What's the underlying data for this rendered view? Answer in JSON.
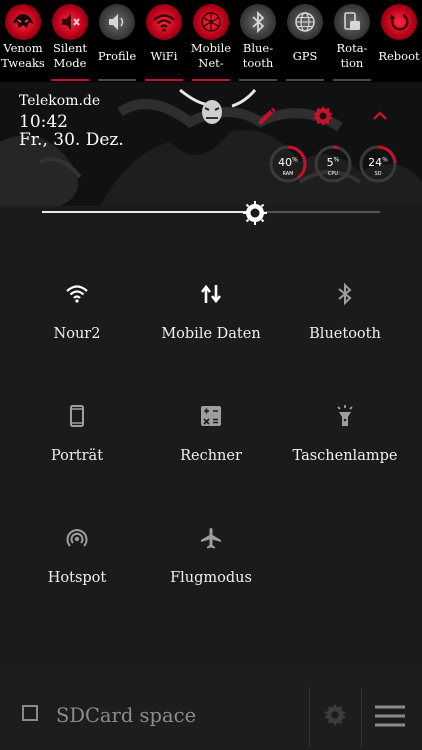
{
  "toggles": [
    {
      "line1": "Venom",
      "line2": "Tweaks",
      "icon": "venom-logo-icon",
      "active": true
    },
    {
      "line1": "Silent",
      "line2": "Mode",
      "icon": "speaker-mute-icon",
      "active": true
    },
    {
      "line1": "Profile",
      "line2": "",
      "icon": "speaker-icon",
      "active": false
    },
    {
      "line1": "WiFi",
      "line2": "",
      "icon": "wifi-icon",
      "active": true
    },
    {
      "line1": "Mobile",
      "line2": "Net-",
      "icon": "mobile-network-icon",
      "active": true
    },
    {
      "line1": "Blue-",
      "line2": "tooth",
      "icon": "bluetooth-icon",
      "active": false
    },
    {
      "line1": "GPS",
      "line2": "",
      "icon": "globe-icon",
      "active": false
    },
    {
      "line1": "Rota-",
      "line2": "tion",
      "icon": "rotation-icon",
      "active": false
    },
    {
      "line1": "Reboot",
      "line2": "",
      "icon": "reboot-icon",
      "active": true
    }
  ],
  "header": {
    "carrier": "Telekom.de",
    "time": "10:42",
    "date": "Fr., 30. Dez."
  },
  "gauges": [
    {
      "value": "40",
      "unit": "%",
      "label": "RAM",
      "fraction": 0.4
    },
    {
      "value": "5",
      "unit": "%",
      "label": "CPU",
      "fraction": 0.05
    },
    {
      "value": "24",
      "unit": "%",
      "label": "SD",
      "fraction": 0.24
    }
  ],
  "brightness": {
    "level": 0.63
  },
  "tiles": [
    {
      "label": "Nour2",
      "icon": "wifi-icon",
      "active": true
    },
    {
      "label": "Mobile Daten",
      "icon": "data-arrows-icon",
      "active": true
    },
    {
      "label": "Bluetooth",
      "icon": "bluetooth-icon",
      "active": false
    },
    {
      "label": "Porträt",
      "icon": "phone-portrait-icon",
      "active": false
    },
    {
      "label": "Rechner",
      "icon": "calculator-icon",
      "active": false
    },
    {
      "label": "Taschenlampe",
      "icon": "flashlight-icon",
      "active": false
    },
    {
      "label": "Hotspot",
      "icon": "hotspot-icon",
      "active": false
    },
    {
      "label": "Flugmodus",
      "icon": "airplane-icon",
      "active": false
    }
  ],
  "footer": {
    "sdcard_label": "SDCard space",
    "sdcard_checked": false
  },
  "colors": {
    "accent_red": "#c8102e",
    "icon_active": "#ffffff",
    "icon_inactive": "#9e9e9e"
  }
}
